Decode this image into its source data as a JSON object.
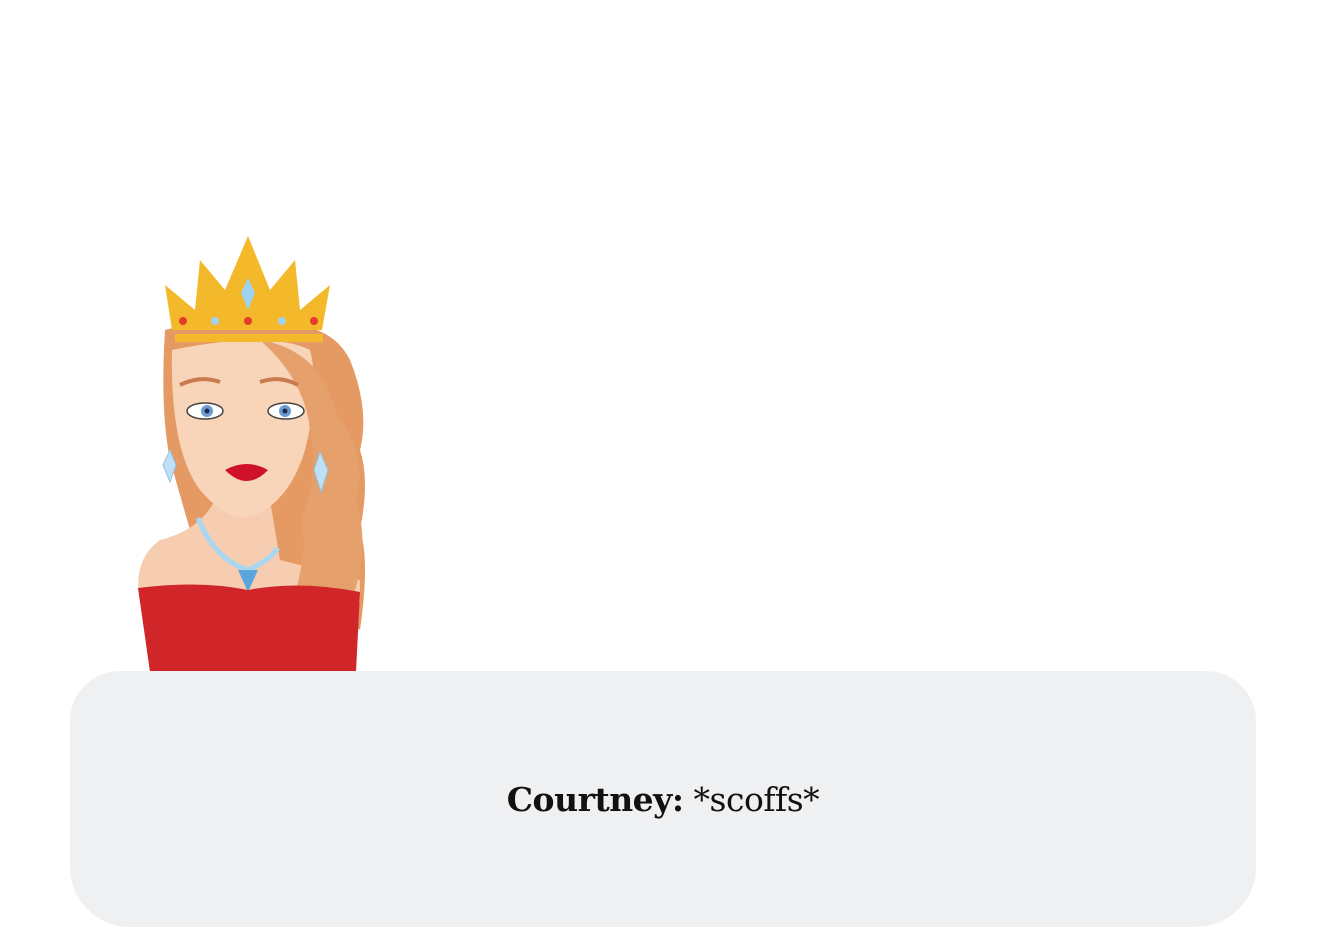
{
  "scene": {
    "character_name": "Courtney"
  },
  "dialog": {
    "speaker": "Courtney:",
    "text": " *scoffs*"
  },
  "colors": {
    "dialog_bg": "#eff0f2",
    "dress": "#d0262a",
    "crown": "#f3b92b",
    "hair": "#e59a63",
    "skin": "#f6cdb0"
  }
}
